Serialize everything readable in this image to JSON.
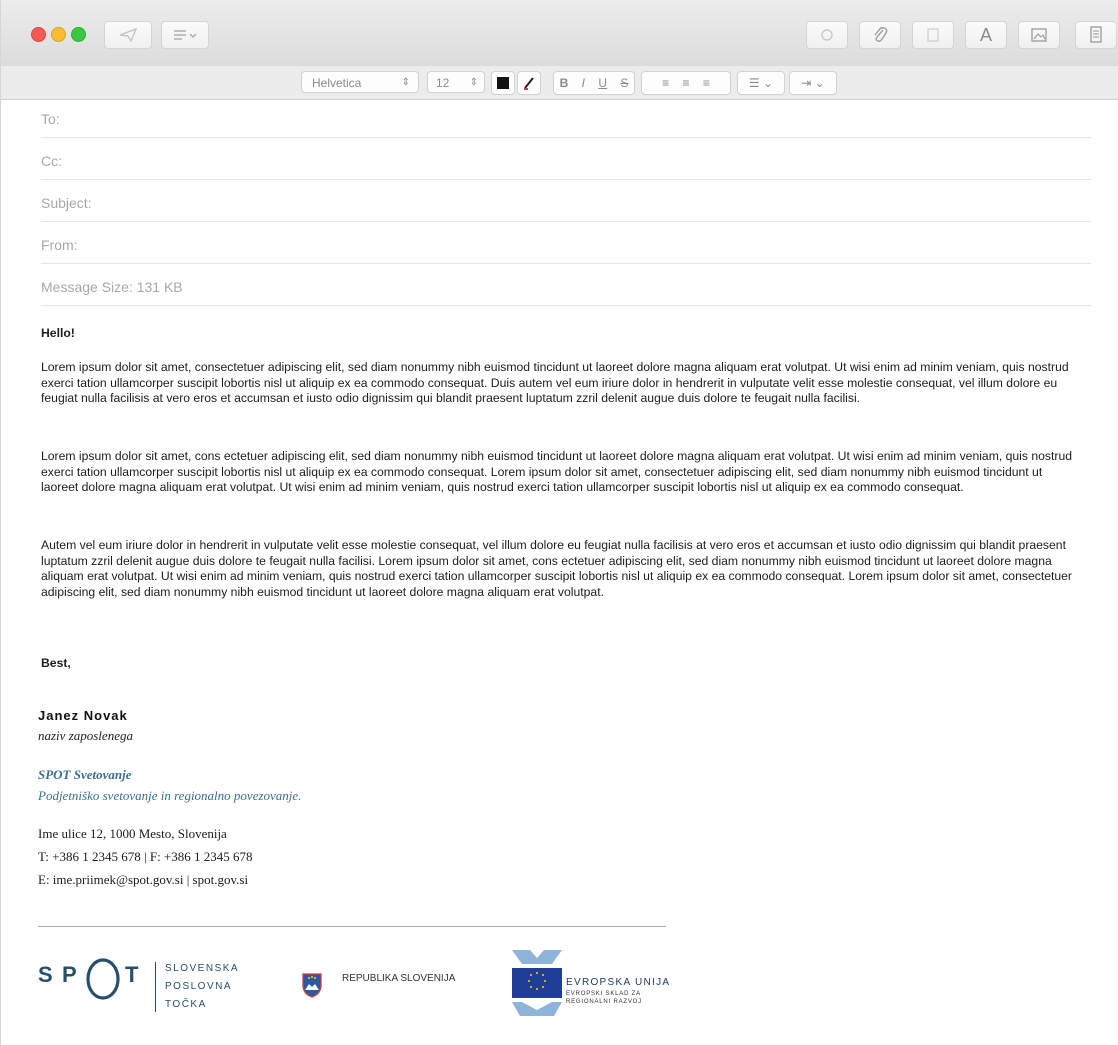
{
  "toolbar": {
    "font_family": "Helvetica",
    "font_size": "12",
    "icons": [
      "send-icon",
      "header-fields-icon",
      "format-font-icon",
      "attach-icon",
      "markup-icon",
      "fonts-icon",
      "photo-browser-icon",
      "stationery-icon"
    ]
  },
  "fields": {
    "to_label": "To:",
    "cc_label": "Cc:",
    "subject_label": "Subject:",
    "from_label": "From:",
    "message_size": "Message Size: 131 KB"
  },
  "body": {
    "greeting": "Hello!",
    "para1": "Lorem ipsum dolor sit amet, consectetuer adipiscing elit, sed diam nonummy nibh euismod tincidunt ut laoreet dolore magna aliquam erat volutpat. Ut wisi enim ad minim veniam, quis nostrud exerci tation ullamcorper suscipit lobortis nisl ut aliquip ex ea commodo consequat. Duis autem vel eum iriure dolor in hendrerit in vulputate velit esse molestie consequat, vel illum dolore eu feugiat nulla facilisis at vero eros et accumsan et iusto odio dignissim qui blandit praesent luptatum zzril delenit augue duis dolore te feugait nulla facilisi.",
    "para2": "Lorem ipsum dolor sit amet, cons ectetuer adipiscing elit, sed diam nonummy nibh euismod tincidunt ut laoreet dolore magna aliquam erat volutpat. Ut wisi enim ad minim veniam, quis nostrud exerci tation ullamcorper suscipit lobortis nisl ut aliquip ex ea commodo consequat. Lorem ipsum dolor sit amet, consectetuer adipiscing elit, sed diam nonummy nibh euismod tincidunt ut laoreet dolore magna aliquam erat volutpat. Ut wisi enim ad minim veniam, quis nostrud exerci tation ullamcorper suscipit lobortis nisl ut aliquip ex ea commodo consequat.",
    "para3": "Autem vel eum iriure dolor in hendrerit in vulputate velit esse molestie consequat, vel illum dolore eu feugiat nulla facilisis at vero eros et accumsan et iusto odio dignissim qui blandit praesent luptatum zzril delenit augue duis dolore te feugait nulla facilisi. Lorem ipsum dolor sit amet, cons ectetuer adipiscing elit, sed diam nonummy nibh euismod tincidunt ut laoreet dolore magna aliquam erat volutpat. Ut wisi enim ad minim veniam, quis nostrud exerci tation ullamcorper suscipit lobortis nisl ut aliquip ex ea commodo consequat. Lorem ipsum dolor sit amet, consectetuer adipiscing elit, sed diam nonummy nibh euismod tincidunt ut laoreet dolore magna aliquam erat volutpat.",
    "closing": "Best,"
  },
  "signature": {
    "name": "Janez Novak",
    "title": "naziv zaposlenega",
    "company": "SPOT Svetovanje",
    "tagline": "Podjetniško svetovanje in regionalno povezovanje.",
    "address": "Ime ulice 12, 1000 Mesto, Slovenija",
    "phone": "T: +386 1 2345 678 | F: +386 1 2345 678",
    "email": "E: ime.priimek@spot.gov.si | spot.gov.si"
  },
  "logos": {
    "spot_s": "S",
    "spot_p": "P",
    "spot_t": "T",
    "spot_line1": "SLOVENSKA",
    "spot_line2": "POSLOVNA",
    "spot_line3": "TOČKA",
    "republika": "REPUBLIKA SLOVENIJA",
    "eu_line1": "EVROPSKA UNIJA",
    "eu_line2": "EVROPSKI SKLAD ZA",
    "eu_line3": "REGIONALNI RAZVOJ"
  },
  "colors": {
    "accent": "#3a6f8f",
    "spot_blue": "#254f6b",
    "eu_blue": "#1f3f97",
    "eu_yellow": "#ffd200",
    "close": "#f25b52",
    "minimize": "#f6bd2f",
    "maximize": "#3dc646"
  }
}
